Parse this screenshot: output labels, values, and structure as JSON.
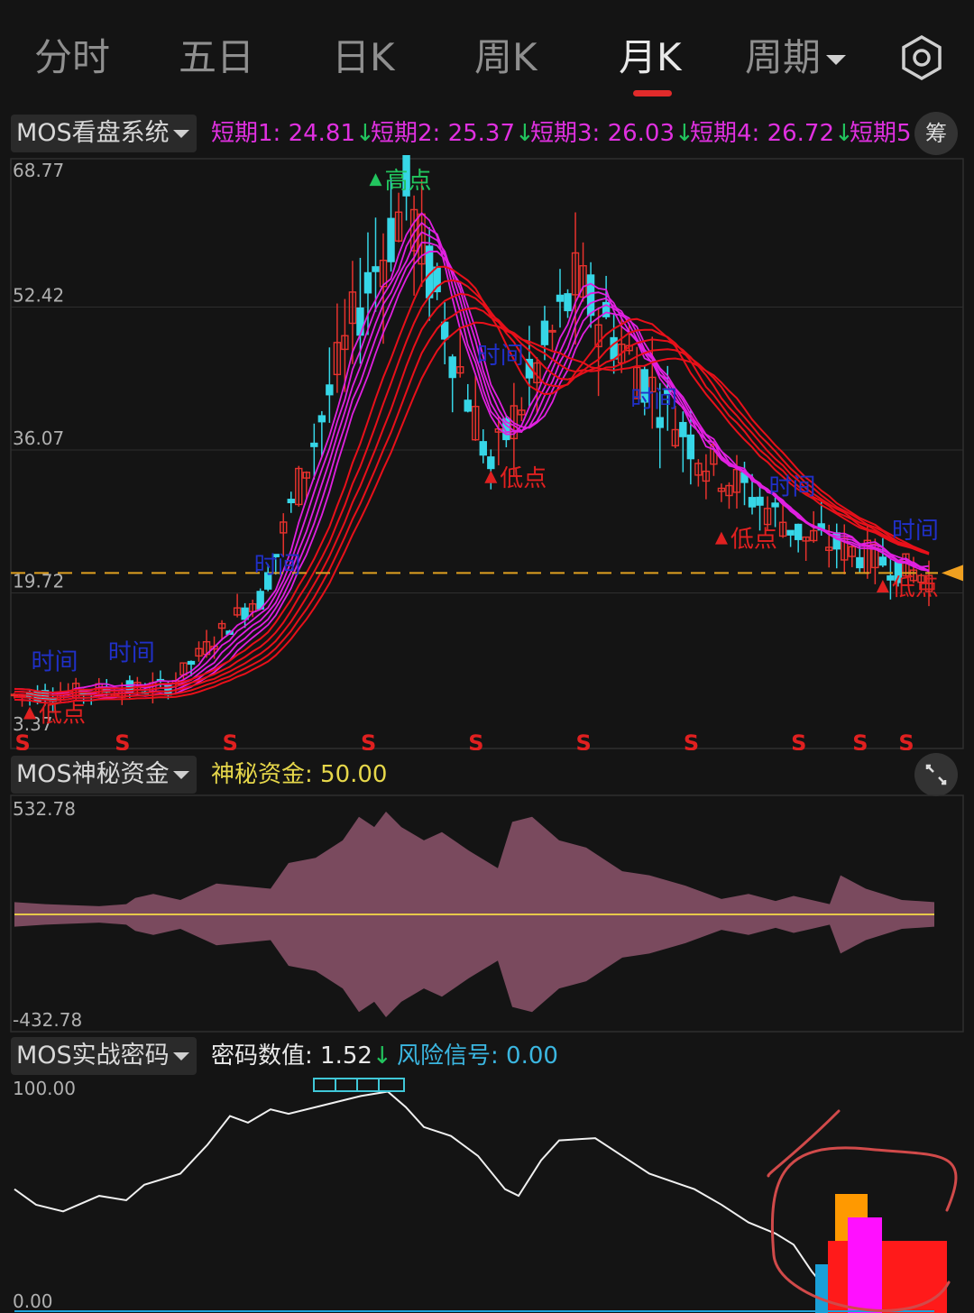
{
  "tabs": [
    {
      "label": "分时"
    },
    {
      "label": "五日"
    },
    {
      "label": "日K"
    },
    {
      "label": "周K"
    },
    {
      "label": "月K",
      "active": true
    },
    {
      "label": "周期"
    }
  ],
  "settings_icon": "gear-icon",
  "panel1": {
    "selector": "MOS看盘系统",
    "legend": [
      {
        "text": "短期1: 24.81",
        "arrow": "↓"
      },
      {
        "text": "短期2: 25.37",
        "arrow": "↓"
      },
      {
        "text": "短期3: 26.03",
        "arrow": "↓"
      },
      {
        "text": "短期4: 26.72",
        "arrow": "↓"
      },
      {
        "text": "短期5"
      }
    ],
    "chip_button": "筹",
    "y_axis": [
      "68.77",
      "52.42",
      "36.07",
      "19.72",
      "3.37"
    ],
    "price_line": 22.0,
    "labels": {
      "high": "高点",
      "low": "低点",
      "time": "时间",
      "sell": "S"
    },
    "colors": {
      "up": "#e8322d",
      "down": "#36d6e7",
      "short_ma": "#e020e0",
      "long_ma": "#e8101a",
      "price_line": "#e0a020"
    }
  },
  "panel2": {
    "selector": "MOS神秘资金",
    "legend": "神秘资金: 50.00",
    "expand_icon": "expand-icon",
    "y_axis": [
      "532.78",
      "-432.78"
    ]
  },
  "panel3": {
    "selector": "MOS实战密码",
    "legend1": "密码数值: 1.52",
    "legend1_arrow": "↓",
    "legend2": "风险信号: 0.00",
    "y_axis": [
      "100.00",
      "0.00"
    ]
  }
}
